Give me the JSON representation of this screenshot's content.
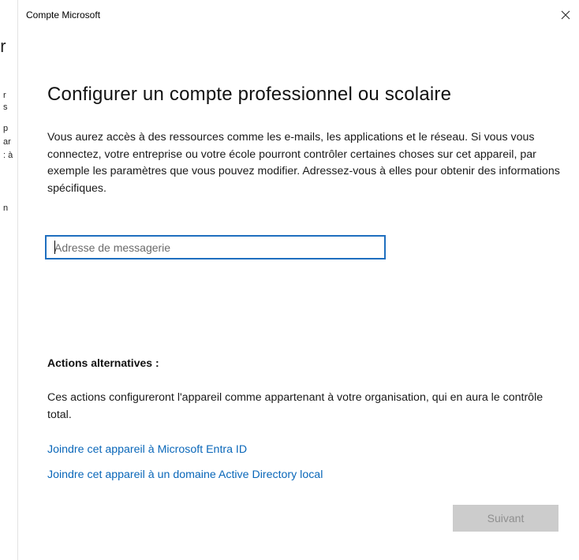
{
  "background": {
    "title_fragment": "'r",
    "fragments": [
      "r",
      "s",
      "p",
      "ar",
      ": à",
      "",
      "",
      "n"
    ]
  },
  "dialog": {
    "title": "Compte Microsoft",
    "close_icon": "close-icon"
  },
  "main": {
    "heading": "Configurer un compte professionnel ou scolaire",
    "description": "Vous aurez accès à des ressources comme les e-mails, les applications et le réseau. Si vous vous connectez, votre entreprise ou votre école pourront contrôler certaines choses sur cet appareil, par exemple les paramètres que vous pouvez modifier. Adressez-vous à elles pour obtenir des informations spécifiques.",
    "email": {
      "value": "",
      "placeholder": "Adresse de messagerie"
    }
  },
  "alternatives": {
    "heading": "Actions alternatives :",
    "description": "Ces actions configureront l'appareil comme appartenant à votre organisation, qui en aura le contrôle total.",
    "links": [
      "Joindre cet appareil à Microsoft Entra ID",
      "Joindre cet appareil à un domaine Active Directory local"
    ]
  },
  "footer": {
    "next_label": "Suivant"
  },
  "colors": {
    "accent": "#1f6fbf",
    "link": "#0a67b9",
    "disabled_button_bg": "#cccccc",
    "disabled_button_text": "#8f8f8f"
  }
}
